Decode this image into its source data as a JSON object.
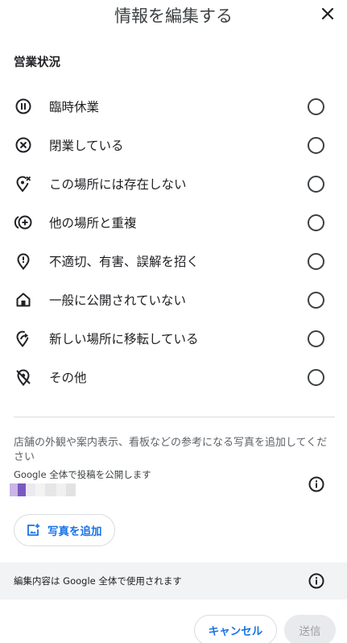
{
  "header": {
    "title": "情報を編集する",
    "close_icon": "close-icon"
  },
  "status": {
    "title": "営業状況",
    "options": [
      {
        "label": "臨時休業",
        "icon": "pause-circle-icon"
      },
      {
        "label": "閉業している",
        "icon": "cancel-circle-icon"
      },
      {
        "label": "この場所には存在しない",
        "icon": "location-off-icon"
      },
      {
        "label": "他の場所と重複",
        "icon": "duplicate-location-icon"
      },
      {
        "label": "不適切、有害、誤解を招く",
        "icon": "location-alert-icon"
      },
      {
        "label": "一般に公開されていない",
        "icon": "home-icon"
      },
      {
        "label": "新しい場所に移転している",
        "icon": "moved-location-icon"
      },
      {
        "label": "その他",
        "icon": "other-location-icon"
      }
    ]
  },
  "photo": {
    "prompt": "店舗の外観や案内表示、看板などの参考になる写真を追加してください",
    "public_note": "Google 全体で投稿を公開します",
    "add_button_label": "写真を追加"
  },
  "notice": {
    "text": "編集内容は Google 全体で使用されます"
  },
  "footer": {
    "cancel_label": "キャンセル",
    "submit_label": "送信"
  },
  "colors": {
    "accent": "#1a73e8",
    "text": "#202124",
    "muted": "#5f6368",
    "divider": "#dadce0",
    "notice_bg": "#f1f3f4",
    "disabled_bg": "#e8eaed"
  }
}
